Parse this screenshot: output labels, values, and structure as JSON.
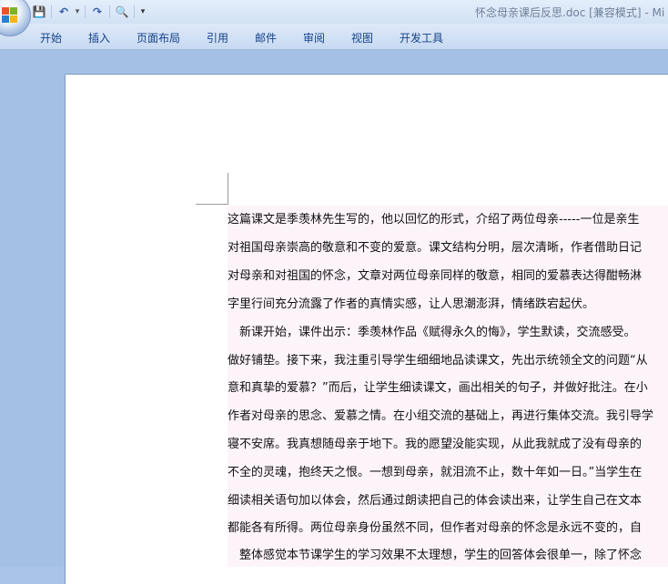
{
  "window": {
    "title": "怀念母亲课后反思.doc [兼容模式] - Mi"
  },
  "quick_access": {
    "save": "💾",
    "undo": "↶",
    "undo_dropdown": "▾",
    "redo": "↷",
    "print_preview": "🔍",
    "customize": "▾"
  },
  "ribbon": {
    "tabs": [
      "开始",
      "插入",
      "页面布局",
      "引用",
      "邮件",
      "审阅",
      "视图",
      "开发工具"
    ]
  },
  "document": {
    "lines": [
      "这篇课文是季羡林先生写的，他以回忆的形式，介绍了两位母亲-----一位是亲生",
      "对祖国母亲崇高的敬意和不变的爱意。课文结构分明，层次清晰，作者借助日记",
      "对母亲和对祖国的怀念，文章对两位母亲同样的敬意，相同的爱慕表达得酣畅淋",
      "字里行间充分流露了作者的真情实感，让人思潮澎湃，情绪跌宕起伏。",
      "　新课开始，课件出示：季羡林作品《赋得永久的悔》，学生默读，交流感受。",
      "做好铺垫。接下来，我注重引导学生细细地品读课文，先出示统领全文的问题“从",
      "意和真挚的爱慕？”而后，让学生细读课文，画出相关的句子，并做好批注。在小",
      "作者对母亲的思念、爱慕之情。在小组交流的基础上，再进行集体交流。我引导学",
      "寝不安席。我真想随母亲于地下。我的愿望没能实现，从此我就成了没有母亲的",
      "不全的灵魂，抱终天之恨。一想到母亲，就泪流不止，数十年如一日。”当学生在",
      "细读相关语句加以体会，然后通过朗读把自己的体会读出来，让学生自己在文本",
      "都能各有所得。两位母亲身份虽然不同，但作者对母亲的怀念是永远不变的，自",
      "　整体感觉本节课学生的学习效果不太理想，学生的回答体会很单一，除了怀念"
    ]
  }
}
